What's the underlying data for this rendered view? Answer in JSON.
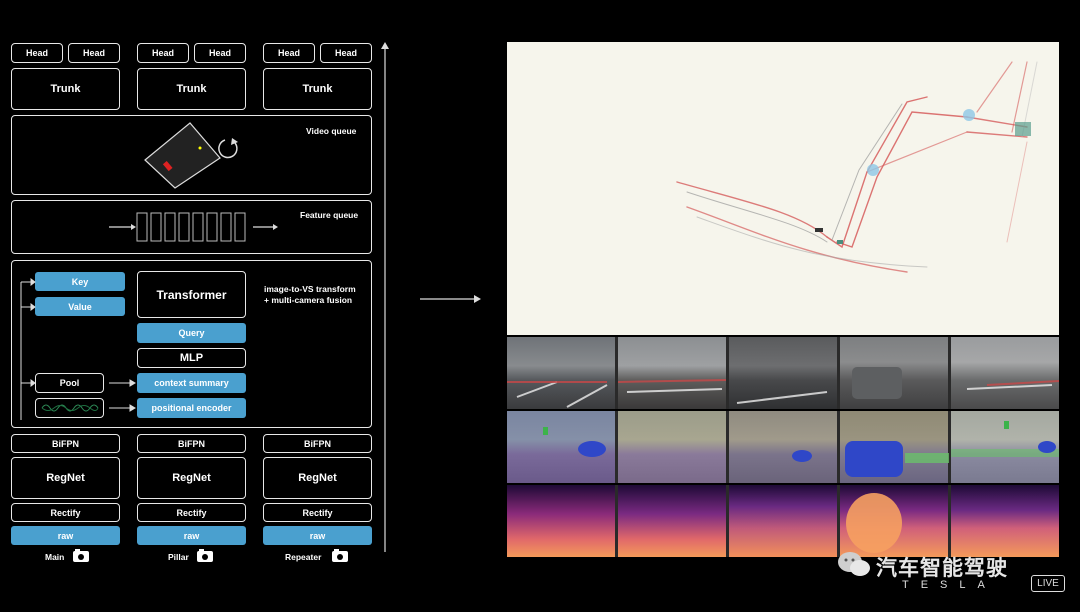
{
  "diagram": {
    "heads": [
      "Head",
      "Head",
      "Head",
      "Head",
      "Head",
      "Head"
    ],
    "trunks": [
      "Trunk",
      "Trunk",
      "Trunk"
    ],
    "video_queue": "Video queue",
    "feature_queue": "Feature queue",
    "fusion": {
      "key": "Key",
      "value": "Value",
      "transformer": "Transformer",
      "query": "Query",
      "mlp": "MLP",
      "pool": "Pool",
      "context_summary": "context summary",
      "positional_encoder": "positional encoder",
      "description_line1": "image-to-VS transform",
      "description_line2": "+ multi-camera fusion"
    },
    "bifpn": [
      "BiFPN",
      "BiFPN",
      "BiFPN"
    ],
    "regnet": [
      "RegNet",
      "RegNet",
      "RegNet"
    ],
    "rectify": [
      "Rectify",
      "Rectify",
      "Rectify"
    ],
    "raw": [
      "raw",
      "raw",
      "raw"
    ],
    "cameras": [
      "Main",
      "Pillar",
      "Repeater"
    ]
  },
  "branding": {
    "watermark": "汽车智能驾驶",
    "logo": "TESLA",
    "live_badge": "LIVE"
  },
  "colors": {
    "accent_blue": "#4aa0cf",
    "box_border": "#e8e8e8",
    "background": "#000000",
    "map_background": "#f6f5ec"
  },
  "icons": [
    "camera-icon",
    "rotate-arrow-icon",
    "arrow-right-icon",
    "arrow-up-icon",
    "wechat-icon"
  ]
}
